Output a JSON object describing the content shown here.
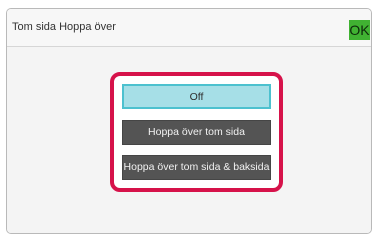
{
  "header": {
    "title": "Tom sida Hoppa över",
    "ok_label": "OK"
  },
  "options": [
    {
      "label": "Off",
      "selected": true
    },
    {
      "label": "Hoppa över tom sida",
      "selected": false
    },
    {
      "label": "Hoppa över tom sida & baksida",
      "selected": false
    }
  ],
  "colors": {
    "highlight_border": "#d6124a",
    "selected_fill": "#a6dfe7",
    "ok_button": "#40b232",
    "unselected_fill": "#545454"
  }
}
